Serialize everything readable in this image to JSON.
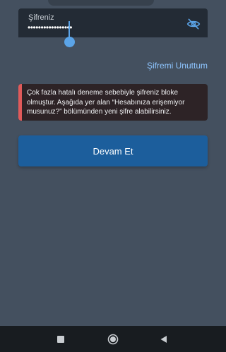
{
  "password_field": {
    "label": "Şifreniz",
    "value": "•••••••••••••••••",
    "visibility_icon": "eye-off-icon"
  },
  "forgot_link": "Şifremi Unuttum",
  "error": {
    "message": "Çok fazla hatalı deneme sebebiyle şifreniz bloke olmuştur. Aşağıda yer alan “Hesabınıza erişemiyor musunuz?” bölümünden yeni şifre alabilirsiniz."
  },
  "continue_button": "Devam Et",
  "nav_bar": {
    "recents_icon": "square-icon",
    "home_icon": "circle-icon",
    "back_icon": "triangle-back-icon"
  },
  "colors": {
    "background": "#44505f",
    "field_background": "#232b35",
    "accent": "#5ba4e8",
    "link": "#8ec5ff",
    "error_accent": "#e05a5a",
    "error_background": "#2d2326",
    "button": "#1c5e9c",
    "nav_bar": "#181c20"
  }
}
